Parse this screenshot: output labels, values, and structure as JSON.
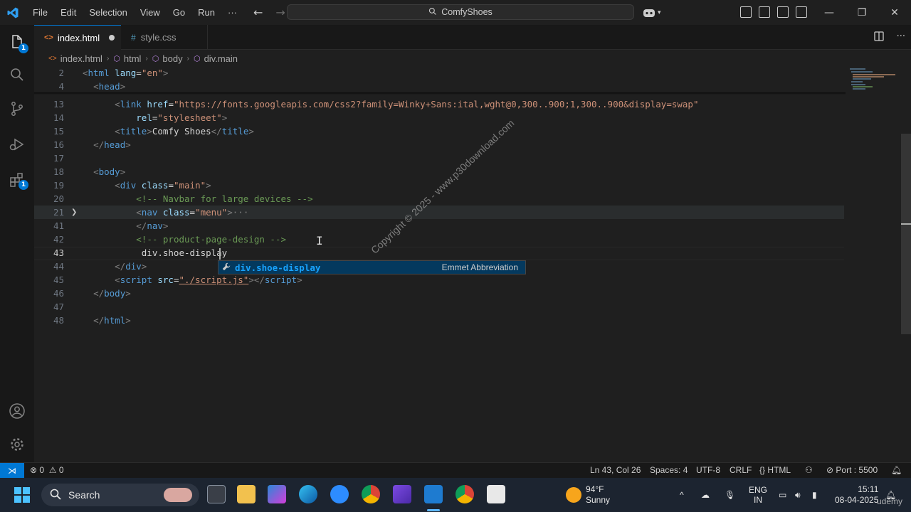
{
  "window": {
    "menu": [
      "File",
      "Edit",
      "Selection",
      "View",
      "Go",
      "Run"
    ],
    "more": "···",
    "command_center": "ComfyShoes"
  },
  "tabs": [
    {
      "label": "index.html",
      "modified": true,
      "active": true
    },
    {
      "label": "style.css",
      "modified": false,
      "active": false
    }
  ],
  "breadcrumb": [
    "index.html",
    "html",
    "body",
    "div.main"
  ],
  "editor": {
    "lines": [
      {
        "n": "2",
        "parts": [
          [
            "t",
            "<"
          ],
          [
            "tag",
            "html"
          ],
          [
            "plain",
            " "
          ],
          [
            "attr",
            "lang"
          ],
          [
            "plain",
            "="
          ],
          [
            "str",
            "\"en\""
          ],
          [
            "t",
            ">"
          ]
        ]
      },
      {
        "n": "4",
        "parts": [
          [
            "plain",
            "  "
          ],
          [
            "t",
            "<"
          ],
          [
            "tag",
            "head"
          ],
          [
            "t",
            ">"
          ]
        ]
      },
      {
        "n": "13",
        "parts": [
          [
            "plain",
            "      "
          ],
          [
            "t",
            "<"
          ],
          [
            "tag",
            "link"
          ],
          [
            "plain",
            " "
          ],
          [
            "attr",
            "href"
          ],
          [
            "plain",
            "="
          ],
          [
            "str",
            "\"https://fonts.googleapis.com/css2?family=Winky+Sans:ital,wght@0,300..900;1,300..900&display=swap\""
          ]
        ]
      },
      {
        "n": "14",
        "parts": [
          [
            "plain",
            "          "
          ],
          [
            "attr",
            "rel"
          ],
          [
            "plain",
            "="
          ],
          [
            "str",
            "\"stylesheet\""
          ],
          [
            "t",
            ">"
          ]
        ]
      },
      {
        "n": "15",
        "parts": [
          [
            "plain",
            "      "
          ],
          [
            "t",
            "<"
          ],
          [
            "tag",
            "title"
          ],
          [
            "t",
            ">"
          ],
          [
            "plain",
            "Comfy Shoes"
          ],
          [
            "t",
            "</"
          ],
          [
            "tag",
            "title"
          ],
          [
            "t",
            ">"
          ]
        ]
      },
      {
        "n": "16",
        "parts": [
          [
            "plain",
            "  "
          ],
          [
            "t",
            "</"
          ],
          [
            "tag",
            "head"
          ],
          [
            "t",
            ">"
          ]
        ]
      },
      {
        "n": "17",
        "parts": []
      },
      {
        "n": "18",
        "parts": [
          [
            "plain",
            "  "
          ],
          [
            "t",
            "<"
          ],
          [
            "tag",
            "body"
          ],
          [
            "t",
            ">"
          ]
        ]
      },
      {
        "n": "19",
        "parts": [
          [
            "plain",
            "      "
          ],
          [
            "t",
            "<"
          ],
          [
            "tag",
            "div"
          ],
          [
            "plain",
            " "
          ],
          [
            "attr",
            "class"
          ],
          [
            "plain",
            "="
          ],
          [
            "str",
            "\"main\""
          ],
          [
            "t",
            ">"
          ]
        ]
      },
      {
        "n": "20",
        "parts": [
          [
            "plain",
            "          "
          ],
          [
            "cm",
            "<!-- Navbar for large devices -->"
          ]
        ]
      },
      {
        "n": "21",
        "parts": [
          [
            "plain",
            "          "
          ],
          [
            "t",
            "<"
          ],
          [
            "tag",
            "nav"
          ],
          [
            "plain",
            " "
          ],
          [
            "attr",
            "class"
          ],
          [
            "plain",
            "="
          ],
          [
            "str",
            "\"menu\""
          ],
          [
            "t",
            ">"
          ],
          [
            "t",
            "···"
          ]
        ]
      },
      {
        "n": "41",
        "parts": [
          [
            "plain",
            "          "
          ],
          [
            "t",
            "</"
          ],
          [
            "tag",
            "nav"
          ],
          [
            "t",
            ">"
          ]
        ]
      },
      {
        "n": "42",
        "parts": [
          [
            "plain",
            "          "
          ],
          [
            "cm",
            "<!-- product-page-design -->"
          ]
        ]
      },
      {
        "n": "43",
        "parts": [
          [
            "plain",
            "           div.shoe-display"
          ]
        ]
      },
      {
        "n": "44",
        "parts": [
          [
            "plain",
            "      "
          ],
          [
            "t",
            "</"
          ],
          [
            "tag",
            "div"
          ],
          [
            "t",
            ">"
          ]
        ]
      },
      {
        "n": "45",
        "parts": [
          [
            "plain",
            "      "
          ],
          [
            "t",
            "<"
          ],
          [
            "tag",
            "script"
          ],
          [
            "plain",
            " "
          ],
          [
            "attr",
            "src"
          ],
          [
            "plain",
            "="
          ],
          [
            "str",
            "\"./script.js\""
          ],
          [
            "t",
            "></"
          ],
          [
            "tag",
            "script"
          ],
          [
            "t",
            ">"
          ]
        ]
      },
      {
        "n": "46",
        "parts": [
          [
            "plain",
            "  "
          ],
          [
            "t",
            "</"
          ],
          [
            "tag",
            "body"
          ],
          [
            "t",
            ">"
          ]
        ]
      },
      {
        "n": "47",
        "parts": []
      },
      {
        "n": "48",
        "parts": [
          [
            "plain",
            "  "
          ],
          [
            "t",
            "</"
          ],
          [
            "tag",
            "html"
          ],
          [
            "t",
            ">"
          ]
        ]
      }
    ],
    "suggestion": {
      "label": "div.shoe-display",
      "detail": "Emmet Abbreviation"
    },
    "watermark": "Copyright © 2025 - www.p30download.com"
  },
  "statusbar": {
    "errors": "0",
    "warnings": "0",
    "position": "Ln 43, Col 26",
    "spaces": "Spaces: 4",
    "encoding": "UTF-8",
    "eol": "CRLF",
    "language": "HTML",
    "port": "Port : 5500"
  },
  "taskbar": {
    "search": "Search",
    "weather_temp": "94°F",
    "weather_desc": "Sunny",
    "lang_top": "ENG",
    "lang_bottom": "IN",
    "time": "15:11",
    "date": "08-04-2025",
    "brand": "udemy"
  }
}
